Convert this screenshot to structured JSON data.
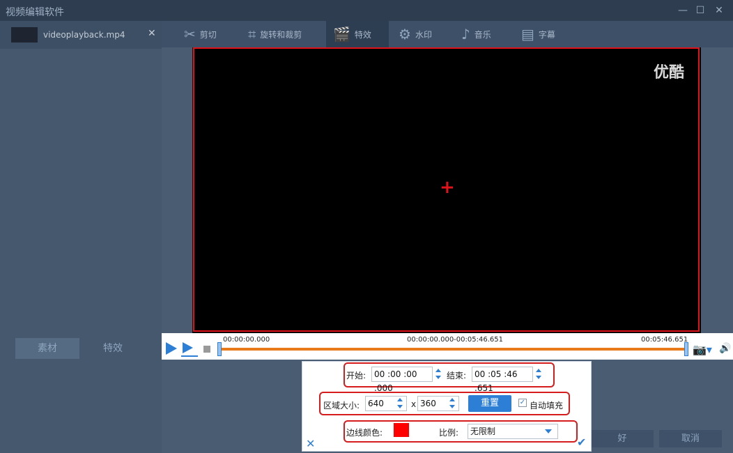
{
  "app": {
    "title": "视频编辑软件"
  },
  "window_controls": {
    "minimize": "—",
    "maximize": "☐",
    "close": "✕"
  },
  "file_tab": {
    "name": "videoplayback.mp4",
    "close": "✕"
  },
  "left_tabs": [
    "素材",
    "特效"
  ],
  "toolbar": {
    "items": [
      {
        "label": "剪切",
        "icon": "scissors-icon"
      },
      {
        "label": "旋转和裁剪",
        "icon": "crop-icon"
      },
      {
        "label": "特效",
        "icon": "film-effects-icon"
      },
      {
        "label": "水印",
        "icon": "film-reel-icon"
      },
      {
        "label": "音乐",
        "icon": "music-note-icon"
      },
      {
        "label": "字幕",
        "icon": "subtitle-icon"
      }
    ]
  },
  "video": {
    "watermark": "优酷"
  },
  "playback": {
    "start_time": "00:00:00.000",
    "range": "00:00:00.000-00:05:46.651",
    "end_time": "00:05:46.651"
  },
  "bottom_buttons": {
    "ok": "好",
    "cancel": "取消"
  },
  "crop_dialog": {
    "start_label": "开始:",
    "start_value": "00 :00 :00 .000",
    "end_label": "结束:",
    "end_value": "00 :05 :46 .651",
    "area_label": "区域大小:",
    "width": "640",
    "times": "x",
    "height": "360",
    "reset_label": "重置",
    "autofill_label": "自动填充",
    "autofill_checked": true,
    "border_color_label": "边线颜色:",
    "border_color": "#ff0000",
    "ratio_label": "比例:",
    "ratio_value": "无限制"
  }
}
